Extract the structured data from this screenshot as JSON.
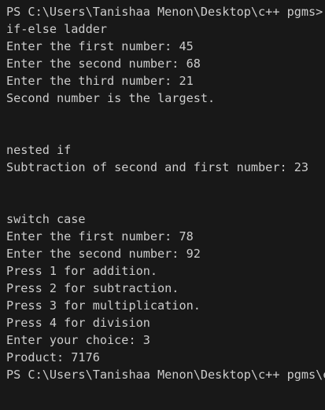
{
  "terminal": {
    "lines": [
      "PS C:\\Users\\Tanishaa Menon\\Desktop\\c++ pgms>",
      "if-else ladder",
      "Enter the first number: 45",
      "Enter the second number: 68",
      "Enter the third number: 21",
      "Second number is the largest.",
      "",
      "",
      "nested if",
      "Subtraction of second and first number: 23",
      "",
      "",
      "switch case",
      "Enter the first number: 78",
      "Enter the second number: 92",
      "Press 1 for addition.",
      "Press 2 for subtraction.",
      "Press 3 for multiplication.",
      "Press 4 for division",
      "Enter your choice: 3",
      "Product: 7176",
      "PS C:\\Users\\Tanishaa Menon\\Desktop\\c++ pgms\\e"
    ]
  },
  "colors": {
    "background": "#181818",
    "text": "#cccccc"
  }
}
